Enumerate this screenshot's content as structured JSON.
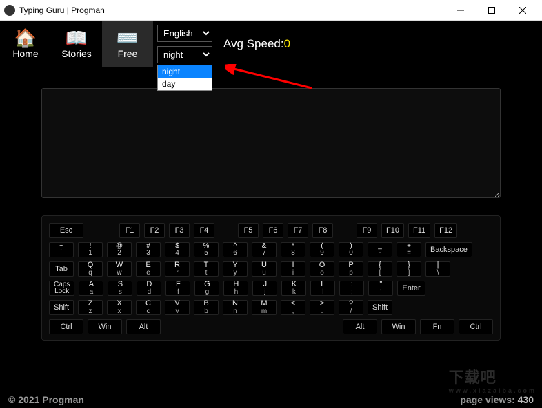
{
  "window": {
    "title": "Typing Guru | Progman"
  },
  "nav": {
    "items": [
      {
        "label": "Home",
        "icon": "🏠"
      },
      {
        "label": "Stories",
        "icon": "📖"
      },
      {
        "label": "Free",
        "icon": "⌨️"
      }
    ],
    "language": {
      "selected": "English"
    },
    "theme": {
      "selected": "night",
      "options": [
        "night",
        "day"
      ]
    },
    "avg_label": "Avg Speed:",
    "avg_value": "0"
  },
  "keyboard": {
    "fn_row": [
      "Esc",
      "F1",
      "F2",
      "F3",
      "F4",
      "F5",
      "F6",
      "F7",
      "F8",
      "F9",
      "F10",
      "F11",
      "F12"
    ],
    "num_row": [
      {
        "t": "~",
        "b": "`"
      },
      {
        "t": "!",
        "b": "1"
      },
      {
        "t": "@",
        "b": "2"
      },
      {
        "t": "#",
        "b": "3"
      },
      {
        "t": "$",
        "b": "4"
      },
      {
        "t": "%",
        "b": "5"
      },
      {
        "t": "^",
        "b": "6"
      },
      {
        "t": "&",
        "b": "7"
      },
      {
        "t": "*",
        "b": "8"
      },
      {
        "t": "(",
        "b": "9"
      },
      {
        "t": ")",
        "b": "0"
      },
      {
        "t": "_",
        "b": "-"
      },
      {
        "t": "+",
        "b": "="
      }
    ],
    "backspace": "Backspace",
    "tab": "Tab",
    "q_row": [
      {
        "t": "Q",
        "b": "q"
      },
      {
        "t": "W",
        "b": "w"
      },
      {
        "t": "E",
        "b": "e"
      },
      {
        "t": "R",
        "b": "r"
      },
      {
        "t": "T",
        "b": "t"
      },
      {
        "t": "Y",
        "b": "y"
      },
      {
        "t": "U",
        "b": "u"
      },
      {
        "t": "I",
        "b": "i"
      },
      {
        "t": "O",
        "b": "o"
      },
      {
        "t": "P",
        "b": "p"
      },
      {
        "t": "{",
        "b": "["
      },
      {
        "t": "}",
        "b": "]"
      },
      {
        "t": "|",
        "b": "\\"
      }
    ],
    "caps": "Caps Lock",
    "a_row": [
      {
        "t": "A",
        "b": "a"
      },
      {
        "t": "S",
        "b": "s"
      },
      {
        "t": "D",
        "b": "d"
      },
      {
        "t": "F",
        "b": "f"
      },
      {
        "t": "G",
        "b": "g"
      },
      {
        "t": "H",
        "b": "h"
      },
      {
        "t": "J",
        "b": "j"
      },
      {
        "t": "K",
        "b": "k"
      },
      {
        "t": "L",
        "b": "l"
      },
      {
        "t": ":",
        "b": ";"
      },
      {
        "t": "\"",
        "b": "'"
      }
    ],
    "enter": "Enter",
    "shift": "Shift",
    "z_row": [
      {
        "t": "Z",
        "b": "z"
      },
      {
        "t": "X",
        "b": "x"
      },
      {
        "t": "C",
        "b": "c"
      },
      {
        "t": "V",
        "b": "v"
      },
      {
        "t": "B",
        "b": "b"
      },
      {
        "t": "N",
        "b": "n"
      },
      {
        "t": "M",
        "b": "m"
      },
      {
        "t": "<",
        "b": ","
      },
      {
        "t": ">",
        "b": "."
      },
      {
        "t": "?",
        "b": "/"
      }
    ],
    "bottom": [
      "Ctrl",
      "Win",
      "Alt",
      "Alt",
      "Win",
      "Fn",
      "Ctrl"
    ]
  },
  "footer": {
    "copyright": "© 2021 Progman",
    "views_label": "page views: ",
    "views": "430"
  },
  "watermark": {
    "big": "下载吧",
    "small": "www.xiazaiba.com"
  }
}
